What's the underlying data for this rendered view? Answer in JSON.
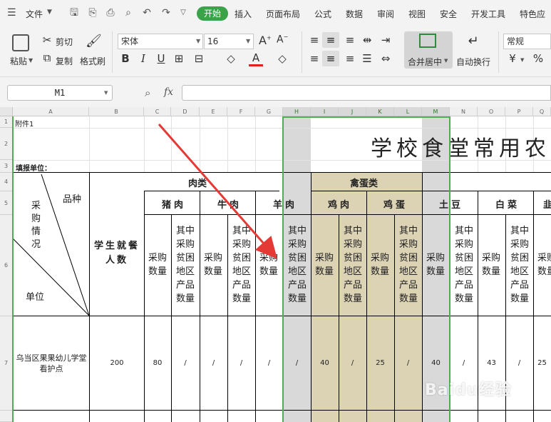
{
  "menubar": {
    "file": "文件",
    "tabs": [
      "开始",
      "插入",
      "页面布局",
      "公式",
      "数据",
      "审阅",
      "视图",
      "安全",
      "开发工具",
      "特色应"
    ]
  },
  "ribbon": {
    "paste": "粘贴",
    "cut": "剪切",
    "copy": "复制",
    "format_painter": "格式刷",
    "font_name": "宋体",
    "font_size": "16",
    "merge_center": "合并居中",
    "wrap_text": "自动换行",
    "number_format": "常规"
  },
  "formula": {
    "cell_ref": "M1",
    "fx": "fx",
    "value": ""
  },
  "sheet": {
    "columns": [
      "A",
      "B",
      "C",
      "D",
      "E",
      "F",
      "G",
      "H",
      "I",
      "J",
      "K",
      "L",
      "M",
      "N",
      "O",
      "P",
      "Q"
    ],
    "rows": [
      "1",
      "2",
      "3",
      "4",
      "5",
      "6",
      "7"
    ],
    "a1": "附件1",
    "title": "学校食堂常用农",
    "filler": "填报单位：",
    "diag_variety": "品种",
    "diag_purchase": "采购情况",
    "diag_unit": "单位",
    "students": "学生就餐人数",
    "group_meat": "肉类",
    "group_poultry": "禽蛋类",
    "sub_pork": "猪肉",
    "sub_beef": "牛肉",
    "sub_mutton": "羊肉",
    "sub_chicken": "鸡肉",
    "sub_egg": "鸡蛋",
    "sub_potato": "土豆",
    "sub_cabbage": "白菜",
    "sub_last": "韭",
    "purchase_qty": "采购数量",
    "poor_area_qty": "其中采购贫困地区产品数量",
    "unit_name": "乌当区果果幼儿学堂看护点",
    "row7_values": [
      "200",
      "80",
      "/",
      "/",
      "/",
      "/",
      "/",
      "40",
      "/",
      "25",
      "/",
      "40",
      "/",
      "43",
      "/",
      "25"
    ]
  },
  "watermark": "Baidu经验"
}
